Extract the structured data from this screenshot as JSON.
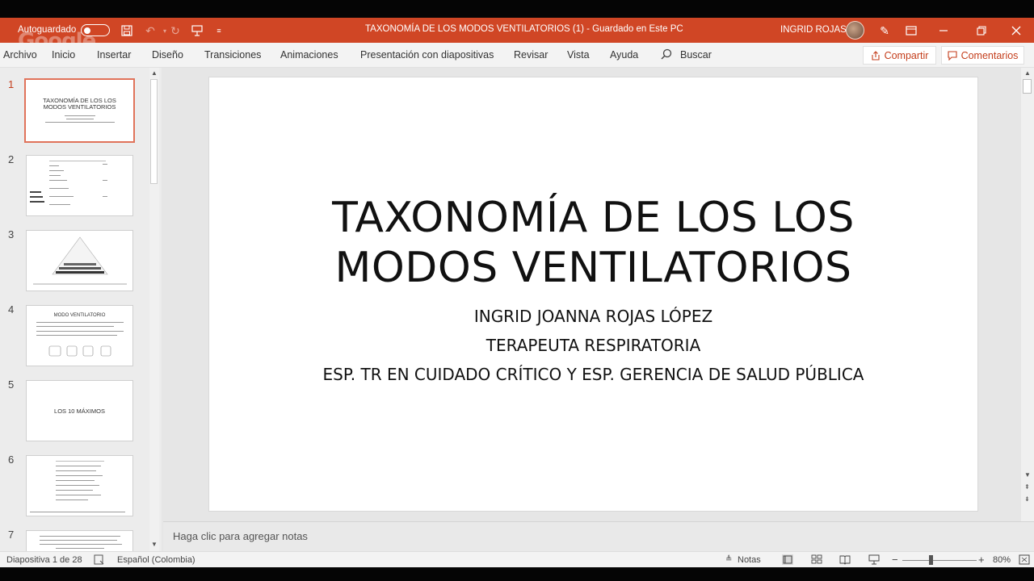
{
  "titlebar": {
    "autosave_label": "Autoguardado",
    "doc_title": "TAXONOMÍA DE LOS MODOS VENTILATORIOS (1)  -  Guardado en Este PC",
    "user_name": "INGRID ROJAS",
    "watermark": "Google"
  },
  "menu": {
    "items": [
      "Archivo",
      "Inicio",
      "Insertar",
      "Diseño",
      "Transiciones",
      "Animaciones",
      "Presentación con diapositivas",
      "Revisar",
      "Vista",
      "Ayuda"
    ],
    "search_label": "Buscar",
    "share_label": "Compartir",
    "comments_label": "Comentarios"
  },
  "thumbnails": [
    {
      "num": "1",
      "title": "TAXONOMÍA DE LOS LOS MODOS VENTILATORIOS"
    },
    {
      "num": "2"
    },
    {
      "num": "3"
    },
    {
      "num": "4",
      "title": "MODO VENTILATORIO"
    },
    {
      "num": "5",
      "title": "LOS 10 MÁXIMOS"
    },
    {
      "num": "6"
    },
    {
      "num": "7"
    }
  ],
  "slide": {
    "title_line1": "TAXONOMÍA DE LOS LOS",
    "title_line2": "MODOS VENTILATORIOS",
    "sub1": "INGRID JOANNA ROJAS LÓPEZ",
    "sub2": "TERAPEUTA RESPIRATORIA",
    "sub3": "ESP. TR EN CUIDADO CRÍTICO Y ESP. GERENCIA DE SALUD PÚBLICA"
  },
  "notes_placeholder": "Haga clic para agregar notas",
  "status": {
    "slide_counter": "Diapositiva 1 de 28",
    "language": "Español (Colombia)",
    "notes_label": "Notas",
    "zoom": "80%"
  },
  "colors": {
    "accent": "#c43e1c",
    "titlebar": "#d04625"
  }
}
